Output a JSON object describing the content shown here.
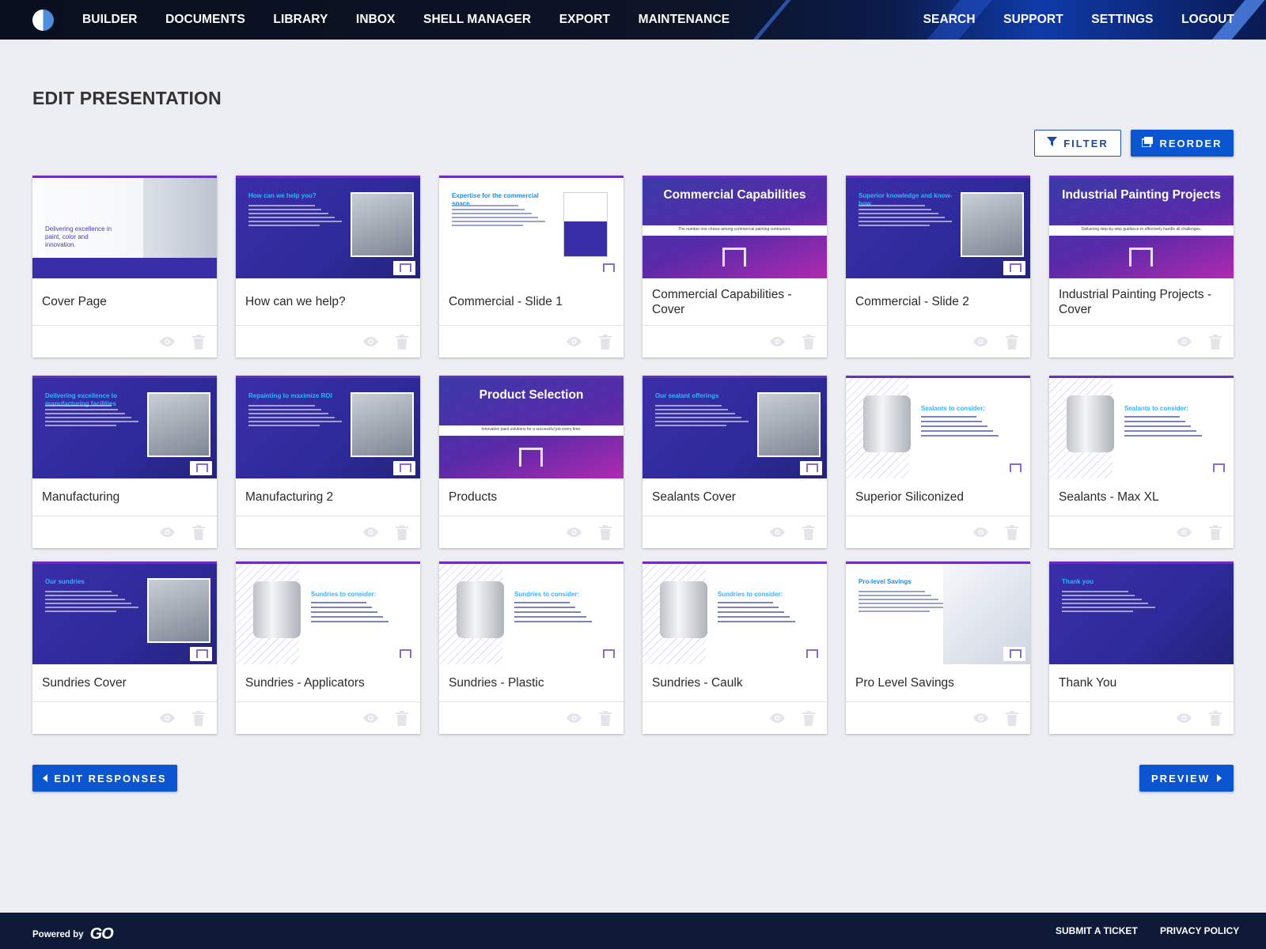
{
  "nav": {
    "left": [
      "BUILDER",
      "DOCUMENTS",
      "LIBRARY",
      "INBOX",
      "SHELL MANAGER",
      "EXPORT",
      "MAINTENANCE"
    ],
    "right": [
      "SEARCH",
      "SUPPORT",
      "SETTINGS",
      "LOGOUT"
    ]
  },
  "page": {
    "title": "EDIT PRESENTATION"
  },
  "toolbar": {
    "filter_label": "FILTER",
    "reorder_label": "REORDER"
  },
  "slides": [
    {
      "label": "Cover Page",
      "thumb_type": "cover-photo",
      "thumb_title": "Delivering excellence in paint, color and innovation."
    },
    {
      "label": "How can we help?",
      "thumb_type": "dark",
      "thumb_title": "How can we help you?"
    },
    {
      "label": "Commercial - Slide 1",
      "thumb_type": "light",
      "thumb_title": "Expertise for the commercial space"
    },
    {
      "label": "Commercial Capabilities - Cover",
      "thumb_type": "cover",
      "thumb_title": "Commercial Capabilities",
      "thumb_sub": "The number one choice among commercial painting contractors."
    },
    {
      "label": "Commercial - Slide 2",
      "thumb_type": "dark",
      "thumb_title": "Superior knowledge and know-how"
    },
    {
      "label": "Industrial Painting Projects - Cover",
      "thumb_type": "cover",
      "thumb_title": "Industrial Painting Projects",
      "thumb_sub": "Delivering step-by-step guidance to effectively handle all challenges."
    },
    {
      "label": "Manufacturing",
      "thumb_type": "dark",
      "thumb_title": "Delivering excellence to manufacturing facilities"
    },
    {
      "label": "Manufacturing 2",
      "thumb_type": "dark",
      "thumb_title": "Repainting to maximize ROI"
    },
    {
      "label": "Products",
      "thumb_type": "cover",
      "thumb_title": "Product Selection",
      "thumb_sub": "Innovative paint solutions for a successful job every time."
    },
    {
      "label": "Sealants Cover",
      "thumb_type": "dark",
      "thumb_title": "Our sealant offerings"
    },
    {
      "label": "Superior Siliconized",
      "thumb_type": "light-product",
      "thumb_title": "Sealants to consider:"
    },
    {
      "label": "Sealants - Max XL",
      "thumb_type": "light-product",
      "thumb_title": "Sealants to consider:"
    },
    {
      "label": "Sundries Cover",
      "thumb_type": "dark",
      "thumb_title": "Our sundries"
    },
    {
      "label": "Sundries - Applicators",
      "thumb_type": "light-product",
      "thumb_title": "Sundries to consider:"
    },
    {
      "label": "Sundries - Plastic",
      "thumb_type": "light-product",
      "thumb_title": "Sundries to consider:"
    },
    {
      "label": "Sundries - Caulk",
      "thumb_type": "light-product",
      "thumb_title": "Sundries to consider:"
    },
    {
      "label": "Pro Level Savings",
      "thumb_type": "light",
      "thumb_title": "Pro-level Savings"
    },
    {
      "label": "Thank You",
      "thumb_type": "dark",
      "thumb_title": "Thank you"
    }
  ],
  "footer_buttons": {
    "back_label": "EDIT RESPONSES",
    "preview_label": "PREVIEW"
  },
  "footer": {
    "powered_by": "Powered by",
    "brand": "GO",
    "links": [
      "SUBMIT A TICKET",
      "PRIVACY POLICY"
    ]
  },
  "colors": {
    "nav_bg": "#0a0f1f",
    "accent": "#0b55d1",
    "page_bg": "#eceef3",
    "footer_bg": "#0e1a38",
    "slide_dark": "#2e2a9a"
  }
}
